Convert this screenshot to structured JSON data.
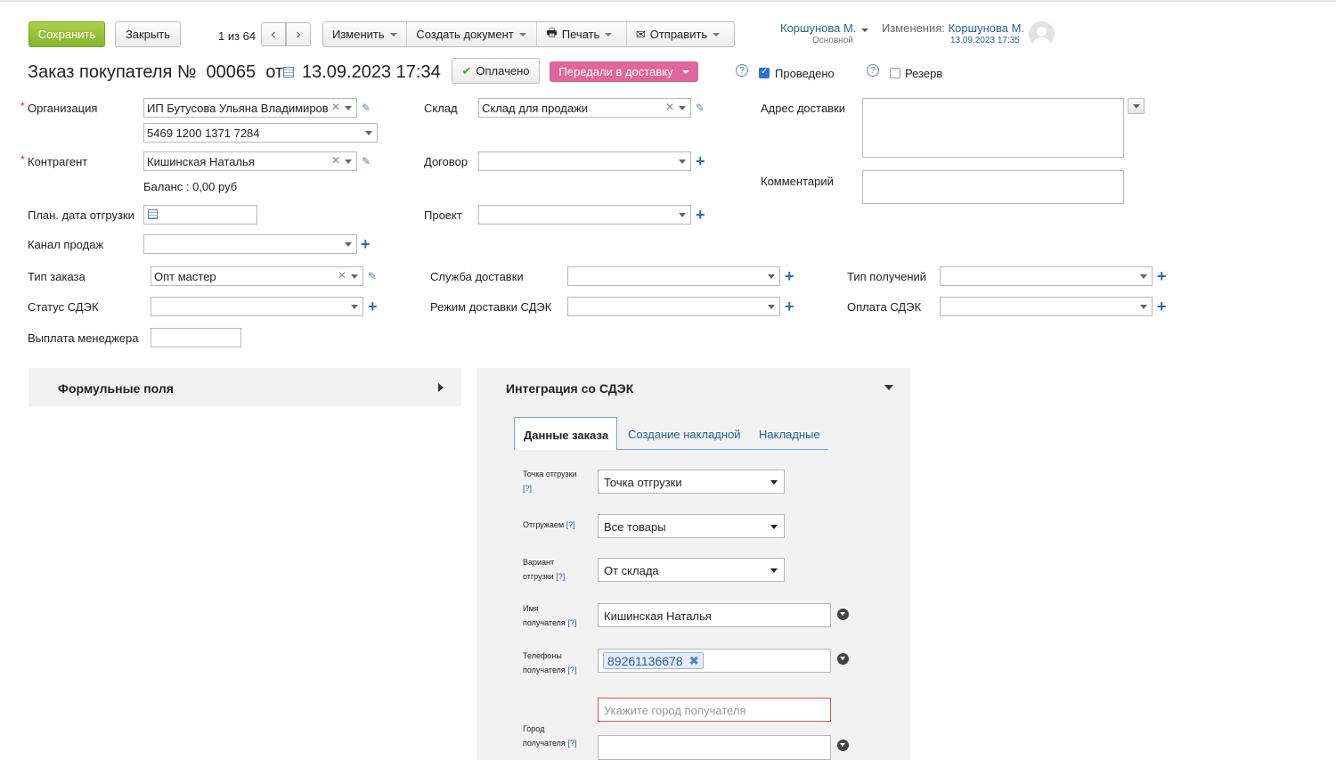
{
  "toolbar": {
    "save": "Сохранить",
    "close": "Закрыть",
    "pager": "1 из 64",
    "edit": "Изменить",
    "create_doc": "Создать документ",
    "print": "Печать",
    "send": "Отправить"
  },
  "user": {
    "name": "Коршунова М.",
    "role": "Основной",
    "changes_label": "Изменения:",
    "changes_user": "Коршунова М.",
    "changes_date": "13.09.2023 17:35"
  },
  "header": {
    "title": "Заказ покупателя №",
    "number": "00065",
    "from": "от",
    "date": "13.09.2023 17:34",
    "paid": "Оплачено",
    "status": "Передали в доставку",
    "posted_label": "Проведено",
    "posted": true,
    "reserve_label": "Резерв",
    "reserve": false
  },
  "form": {
    "org_label": "Организация",
    "org_value": "ИП Бутусова Ульяна Владимиров",
    "account_value": "5469 1200 1371 7284",
    "counterparty_label": "Контрагент",
    "counterparty_value": "Кишинская Наталья",
    "balance": "Баланс : 0,00 руб",
    "plan_date_label": "План. дата отгрузки",
    "channel_label": "Канал продаж",
    "order_type_label": "Тип заказа",
    "order_type_value": "Опт мастер",
    "cdek_status_label": "Статус СДЭК",
    "manager_pay_label": "Выплата менеджера",
    "warehouse_label": "Склад",
    "warehouse_value": "Склад для продажи",
    "contract_label": "Договор",
    "project_label": "Проект",
    "delivery_service_label": "Служба доставки",
    "cdek_mode_label": "Режим доставки СДЭК",
    "receipt_type_label": "Тип получений",
    "cdek_payment_label": "Оплата СДЭК",
    "address_label": "Адрес доставки",
    "comment_label": "Комментарий"
  },
  "formula_panel": {
    "title": "Формульные поля"
  },
  "cdek": {
    "title": "Интеграция со СДЭК",
    "tabs": [
      "Данные заказа",
      "Создание накладной",
      "Накладные"
    ],
    "q": "[?]",
    "ship_point_label_1": "Точка отгрузки",
    "ship_point_value": "Точка отгрузки",
    "shipping_label": "Отгружаем",
    "shipping_value": "Все товары",
    "variant_label_1": "Вариант",
    "variant_label_2": "отгрузки",
    "variant_value": "От склада",
    "name_label_1": "Имя",
    "name_label_2": "получателя",
    "name_value": "Кишинская Наталья",
    "phones_label_1": "Телефоны",
    "phones_label_2": "получателя",
    "phone_value": "89261136678",
    "city_placeholder": "Укажите город получателя",
    "city_label_1": "Город",
    "city_label_2": "получателя"
  }
}
